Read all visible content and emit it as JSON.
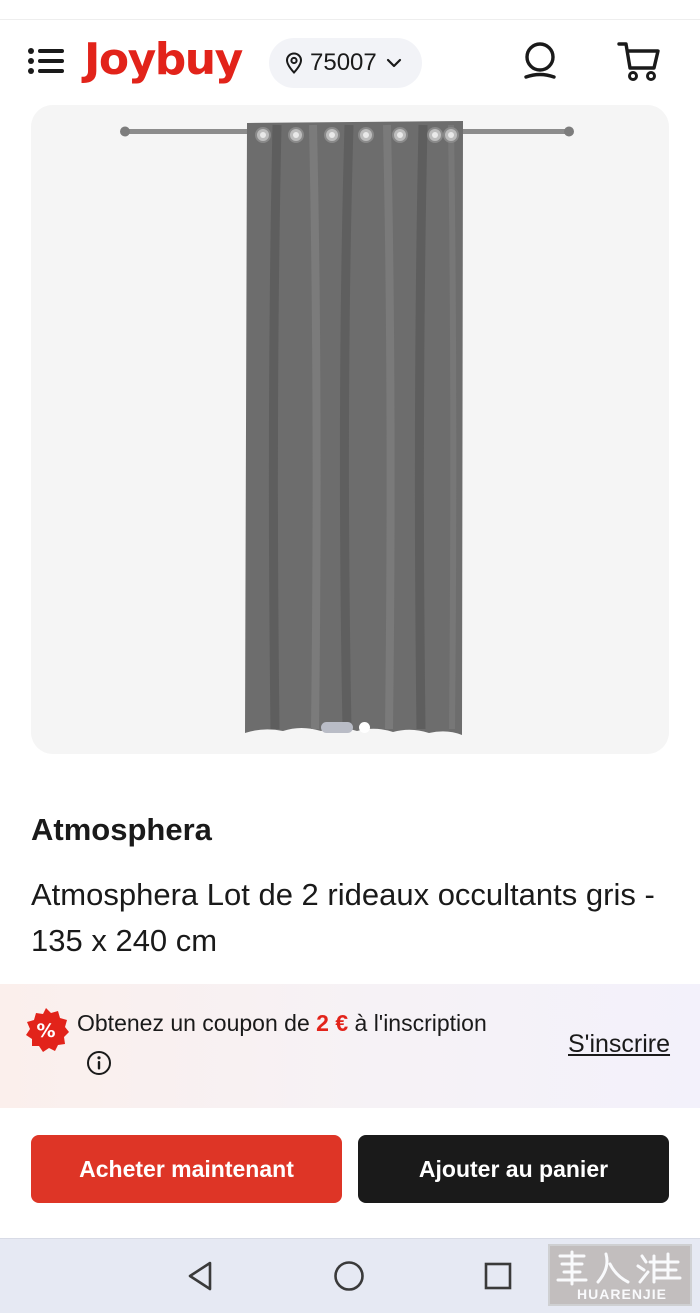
{
  "header": {
    "logo_text": "Joybuy",
    "location_zip": "75007",
    "brand_color": "#e2231a"
  },
  "gallery": {
    "image_description_icon": "curtain-image",
    "slide_count": 2,
    "active_slide": 1
  },
  "product": {
    "brand": "Atmosphera",
    "title": "Atmosphera Lot de 2 rideaux occultants gris - 135 x 240 cm"
  },
  "coupon": {
    "badge_symbol": "%",
    "text_before": "Obtenez un coupon de ",
    "amount": "2 €",
    "text_after": " à l'inscription",
    "signup_label": "S'inscrire",
    "accent_color": "#e2231a"
  },
  "actions": {
    "buy_now_label": "Acheter maintenant",
    "add_to_cart_label": "Ajouter au panier",
    "buy_now_color": "#de3526",
    "add_to_cart_color": "#1a1a1a"
  },
  "system_nav": {
    "icons": [
      "back-triangle-icon",
      "home-circle-icon",
      "recents-square-icon"
    ]
  },
  "watermark": {
    "text": "HUARENJIE"
  }
}
